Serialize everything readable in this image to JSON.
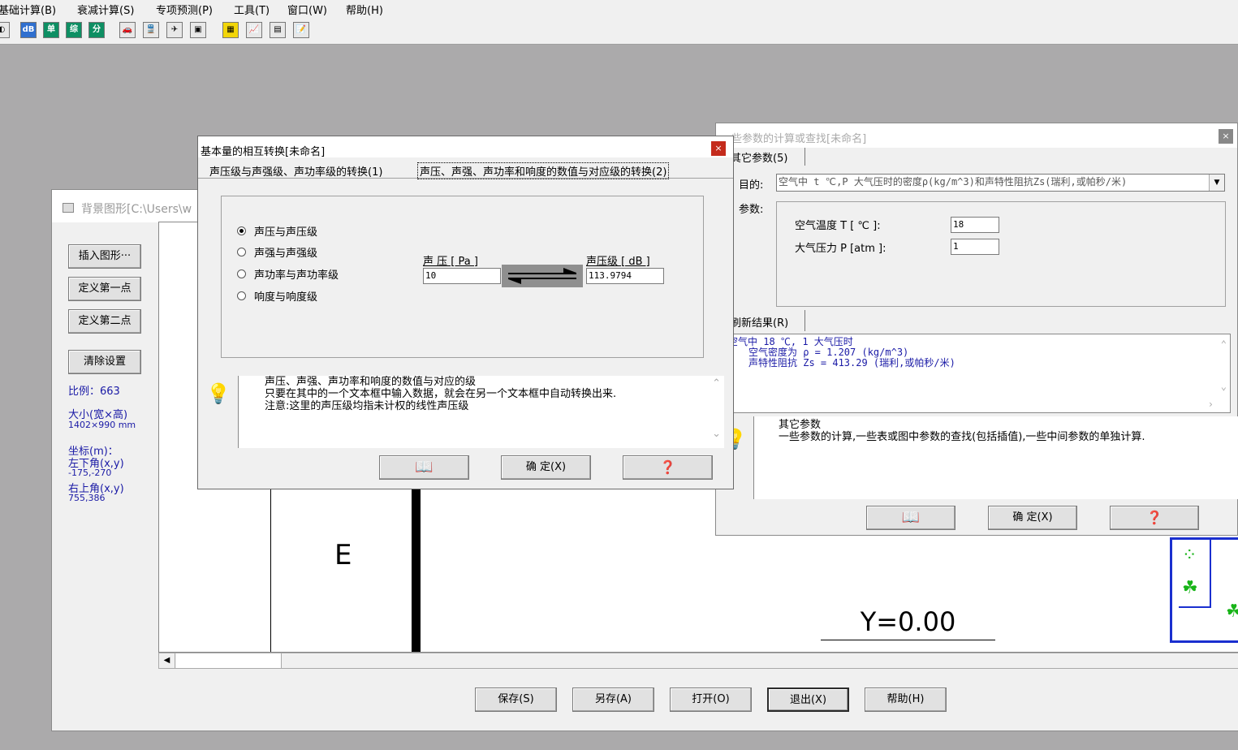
{
  "menu": [
    "基础计算(B)",
    "衰减计算(S)",
    "专项预测(P)",
    "工具(T)",
    "窗口(W)",
    "帮助(H)"
  ],
  "toolbar": {
    "buttons": [
      "dB",
      "单",
      "综",
      "分"
    ],
    "icons": [
      "car-icon",
      "train-icon",
      "plane-icon",
      "display-icon",
      "grid-icon",
      "line-chart-icon",
      "monitor-icon",
      "notepad-icon"
    ]
  },
  "bg_window": {
    "title": "背景图形[C:\\Users\\w",
    "buttons": [
      "插入图形···",
      "定义第一点",
      "定义第二点",
      "清除设置"
    ],
    "scale": "比例：663",
    "size_label": "大小(宽×高)",
    "size_value": "1402×990 mm",
    "coord_label": "坐标(m)：",
    "lower_left_label": "左下角(x,y)",
    "lower_left_value": "-175,-270",
    "upper_right_label": "右上角(x,y)",
    "upper_right_value": "755,386",
    "canvas_letter": "E",
    "canvas_y_label": "Y=0.00",
    "footer_buttons": [
      "保存(S)",
      "另存(A)",
      "打开(O)",
      "退出(X)",
      "帮助(H)"
    ]
  },
  "convert_window": {
    "title": "基本量的相互转换[未命名]",
    "tabs": [
      "声压级与声强级、声功率级的转换(1)",
      "声压、声强、声功率和响度的数值与对应级的转换(2)"
    ],
    "radios": [
      "声压与声压级",
      "声强与声强级",
      "声功率与声功率级",
      "响度与响度级"
    ],
    "selected_radio": 0,
    "left_label": "声 压 [ Pa ]",
    "left_value": "10",
    "right_label": "声压级 [ dB ]",
    "right_value": "113.9794",
    "help_lines": [
      "声压、声强、声功率和响度的数值与对应的级",
      "只要在其中的一个文本框中输入数据，就会在另一个文本框中自动转换出来.",
      "注意:这里的声压级均指未计权的线性声压级"
    ],
    "ok_label": "确 定(X)"
  },
  "param_window": {
    "title": "些参数的计算或查找[未命名]",
    "tab": "其它参数(5)",
    "purpose_label": "目的:",
    "purpose_value": "空气中 t ℃,P 大气压时的密度ρ(kg/m^3)和声特性阻抗Zs(瑞利,或帕秒/米)",
    "params_label": "参数:",
    "temp_label": "空气温度 T [ ℃ ]:",
    "temp_value": "18",
    "pressure_label": "大气压力 P [atm ]:",
    "pressure_value": "1",
    "refresh_label": "刷新结果(R)",
    "result_lines": [
      "空气中 18 ℃, 1 大气压时",
      "空气密度为 ρ = 1.207 (kg/m^3)",
      "声特性阻抗 Zs = 413.29 (瑞利,或帕秒/米)"
    ],
    "help_lines": [
      "其它参数",
      "一些参数的计算,一些表或图中参数的查找(包括插值),一些中间参数的单独计算."
    ],
    "ok_label": "确 定(X)"
  },
  "colors": {
    "desktop": "#abaaab",
    "window": "#f0f0f0",
    "result_text": "#1a1aa6",
    "close": "#c42b1c",
    "toolbar_green": "#0e8f63"
  }
}
